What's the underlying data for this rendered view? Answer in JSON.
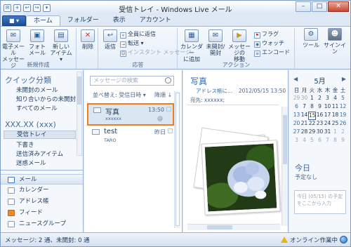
{
  "window": {
    "title": "受信トレイ - Windows Live メール"
  },
  "ribbon_tabs": [
    "ホーム",
    "フォルダー",
    "表示",
    "アカウント"
  ],
  "app_button_label": "■ ▾",
  "ribbon": {
    "new_group": {
      "email_message": "電子メール\nメッセージ",
      "photo_email": "フォト\nメール",
      "new_items": "新しい\nアイテム ▾",
      "label": "新規作成"
    },
    "delete_group": {
      "delete": "削除"
    },
    "respond_group": {
      "reply": "返信",
      "reply_all": "全員に返信",
      "forward": "転送 ▾",
      "instant_message": "インスタント メッセージ",
      "label": "応答"
    },
    "actions_group": {
      "add_to_calendar": "カレンダー\nに追加",
      "unread_read": "未開封/\n開封",
      "move_to": "メッセージの\n移動",
      "flag": "フラグ",
      "watch": "ウォッチ",
      "encoding": "エンコード",
      "label": "アクション"
    },
    "tools": "ツール",
    "sign_in": "サインイン"
  },
  "left_pane": {
    "quick_views_header": "クイック分類",
    "quick_views": [
      "未開封のメール",
      "知り合いからの未開封…",
      "すべてのメール"
    ],
    "account_header": "XXX.XX (xxx)",
    "folders": [
      "受信トレイ",
      "下書き",
      "送信済みアイテム",
      "迷惑メール"
    ],
    "nav": [
      "メール",
      "カレンダー",
      "アドレス帳",
      "フィード",
      "ニュースグループ"
    ]
  },
  "message_list": {
    "search_placeholder": "メッセージの検索",
    "sort_label": "並べ替え: 受信日時 ▾",
    "sort_order": "降順 ↓",
    "messages": [
      {
        "subject": "写真",
        "from": "xxxxxx",
        "time": "13:50",
        "attachment": "@"
      },
      {
        "subject": "test",
        "from": "TARO",
        "time": "昨日"
      }
    ]
  },
  "reading_pane": {
    "title": "写真",
    "from_link": "アドレス帳に…",
    "date": "2012/05/15 13:50",
    "to_line": "宛先: xxxxxx;"
  },
  "calendar": {
    "month": "5月",
    "weekdays": [
      "日",
      "月",
      "火",
      "水",
      "木",
      "金",
      "土"
    ],
    "weeks": [
      [
        "29",
        "30",
        "1",
        "2",
        "3",
        "4",
        "5"
      ],
      [
        "6",
        "7",
        "8",
        "9",
        "10",
        "11",
        "12"
      ],
      [
        "13",
        "14",
        "15",
        "16",
        "17",
        "18",
        "19"
      ],
      [
        "20",
        "21",
        "22",
        "23",
        "24",
        "25",
        "26"
      ],
      [
        "27",
        "28",
        "29",
        "30",
        "31",
        "1",
        "2"
      ],
      [
        "3",
        "4",
        "5",
        "6",
        "7",
        "8",
        "9"
      ]
    ],
    "today_label": "今日",
    "no_events": "予定なし",
    "quick_add_placeholder": "今日 (05/15) の予定をここから入力"
  },
  "status_bar": {
    "counts": "メッセージ: 2 通、未開封: 0 通",
    "online": "オンライン作業中"
  },
  "colors": {
    "highlight": "#f07d1e",
    "accent": "#2e6bb0"
  }
}
